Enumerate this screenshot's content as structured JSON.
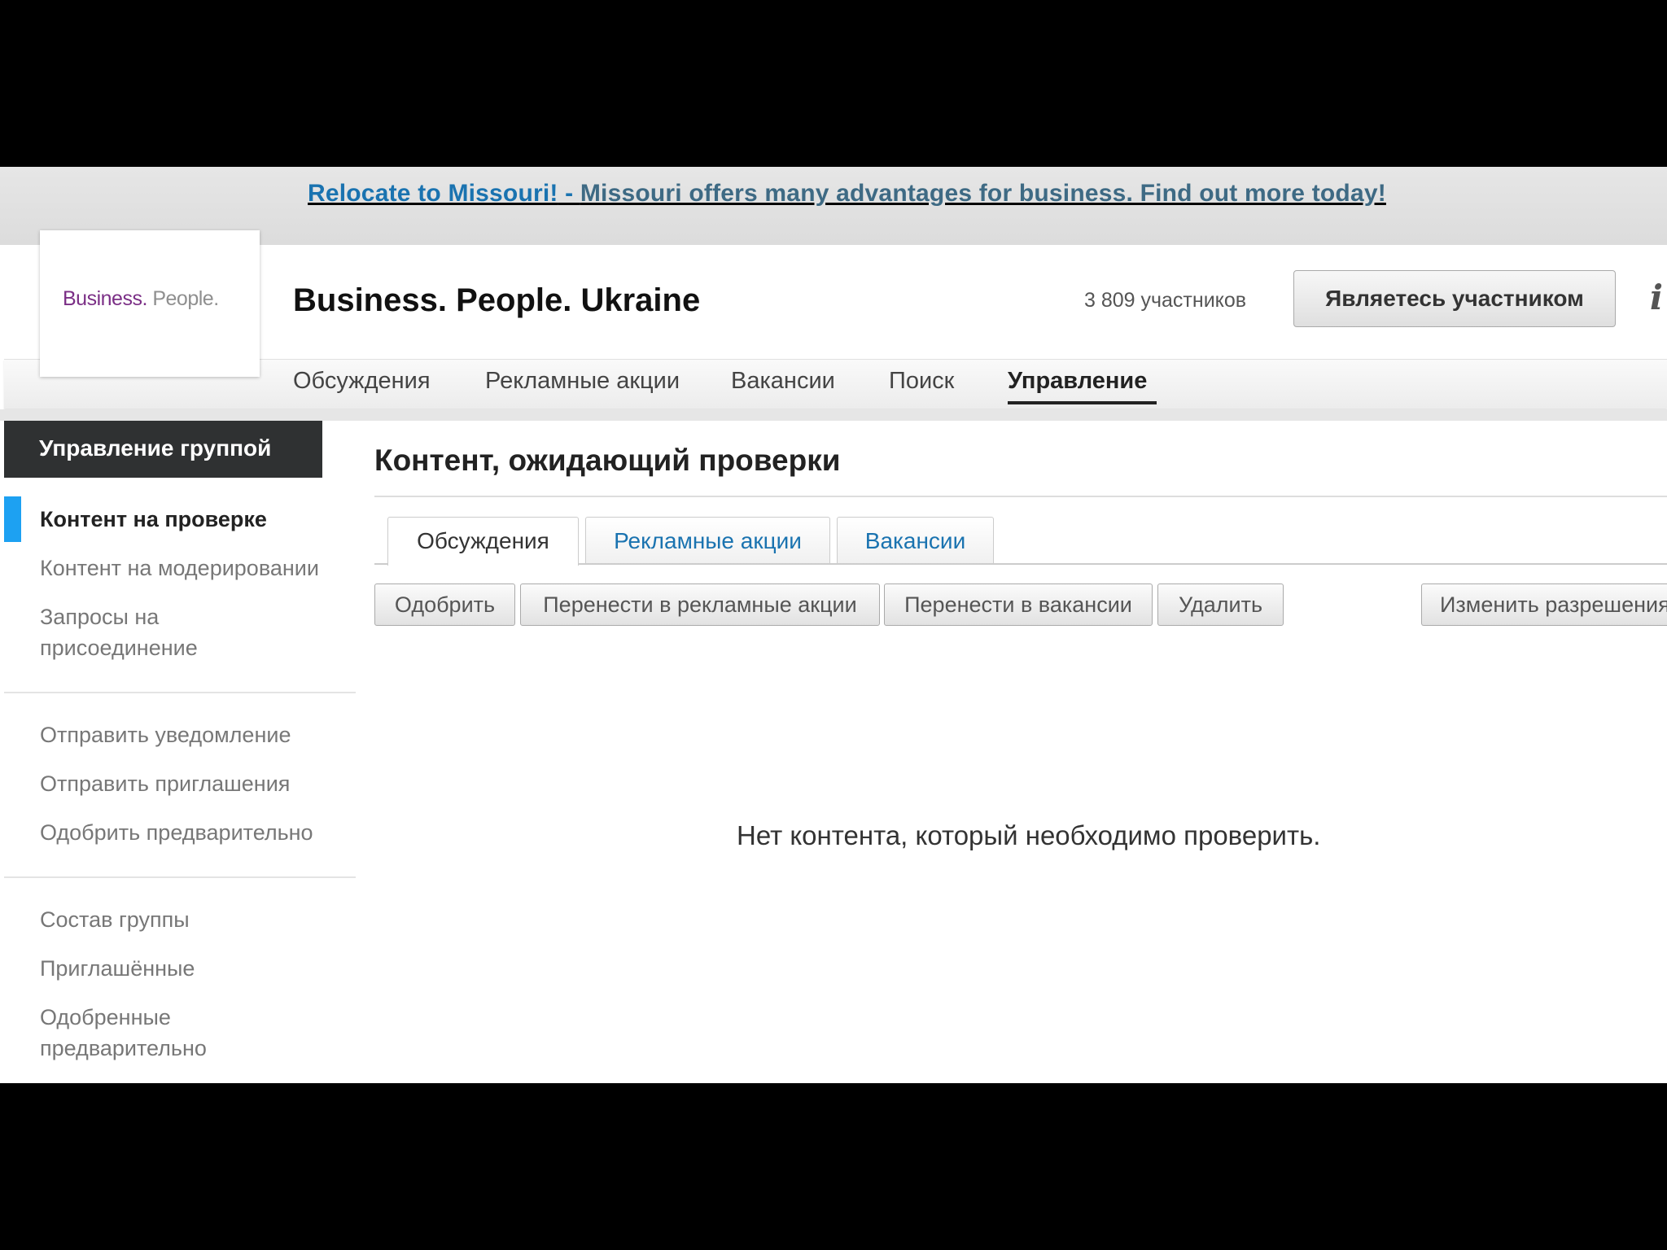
{
  "ad": {
    "title": "Relocate to Missouri!",
    "dash": " - ",
    "text": "Missouri offers many advantages for business. Find out more today!"
  },
  "logo": {
    "word1": "Business",
    "dot": ".",
    "word2": " People."
  },
  "header": {
    "group_title": "Business. People. Ukraine",
    "member_count": "3 809 участников",
    "member_button": "Являетесь участником",
    "info_icon": "i"
  },
  "nav": {
    "items": [
      {
        "label": "Обсуждения"
      },
      {
        "label": "Рекламные акции"
      },
      {
        "label": "Вакансии"
      },
      {
        "label": "Поиск"
      },
      {
        "label": "Управление"
      }
    ],
    "active": "Управление"
  },
  "sidebar": {
    "heading": "Управление группой",
    "group1": [
      {
        "label": "Контент на проверке"
      },
      {
        "label": "Контент на модерировании"
      },
      {
        "label": "Запросы на присоединение"
      }
    ],
    "group2": [
      {
        "label": "Отправить уведомление"
      },
      {
        "label": "Отправить приглашения"
      },
      {
        "label": "Одобрить предварительно"
      }
    ],
    "group3": [
      {
        "label": "Состав группы"
      },
      {
        "label": "Приглашённые"
      },
      {
        "label": "Одобренные предварительно"
      }
    ]
  },
  "main": {
    "title": "Контент, ожидающий проверки",
    "tabs": [
      {
        "label": "Обсуждения"
      },
      {
        "label": "Рекламные акции"
      },
      {
        "label": "Вакансии"
      }
    ],
    "actions": {
      "approve": "Одобрить",
      "move_promotions": "Перенести в рекламные акции",
      "move_jobs": "Перенести в вакансии",
      "delete": "Удалить",
      "change_permissions": "Изменить разрешения"
    },
    "empty_message": "Нет контента, который необходимо проверить."
  },
  "colors": {
    "link_blue": "#1a73b0",
    "brand_purple": "#7b2f86",
    "sidebar_dark": "#2f3132",
    "active_marker": "#1da1f2"
  }
}
